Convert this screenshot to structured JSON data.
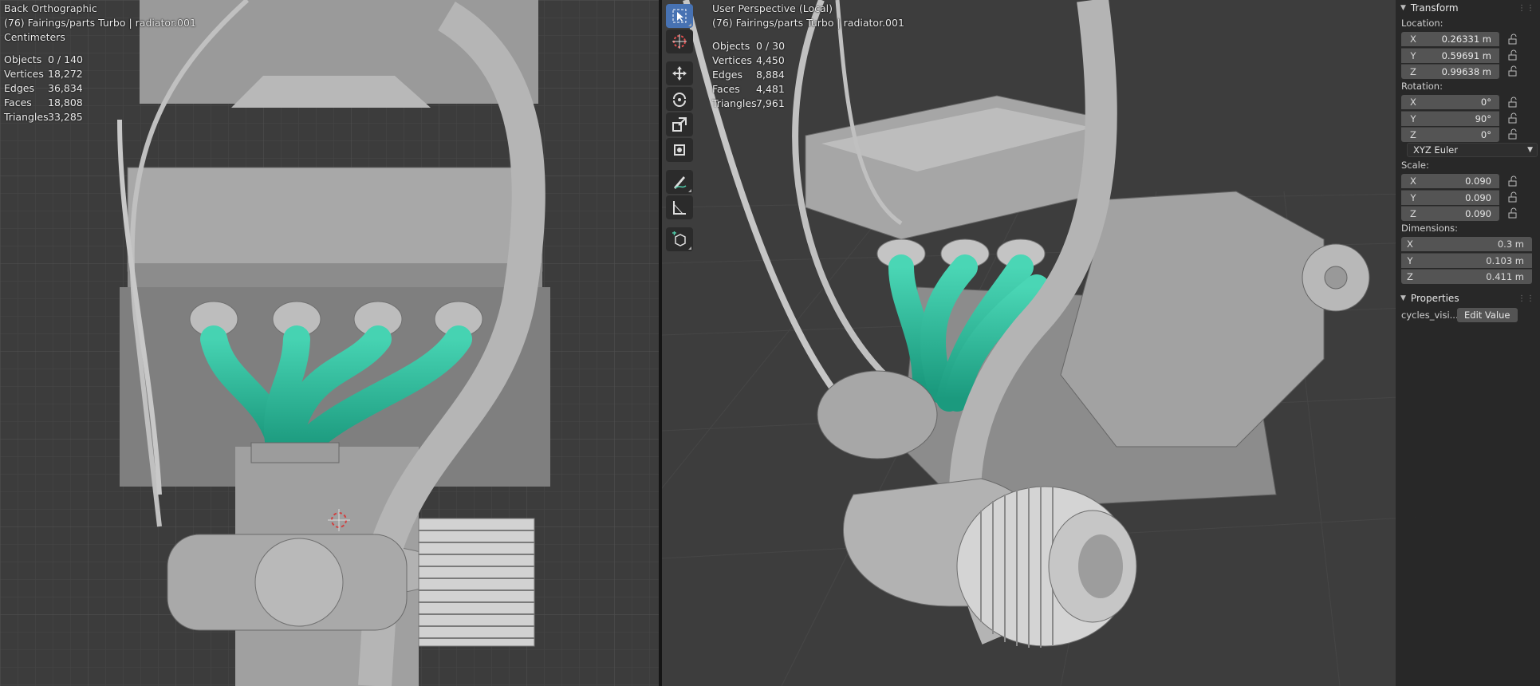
{
  "left_viewport": {
    "view_name": "Back Orthographic",
    "object_path": "(76) Fairings/parts Turbo | radiator.001",
    "units": "Centimeters",
    "stats": [
      {
        "label": "Objects",
        "value": "0 / 140"
      },
      {
        "label": "Vertices",
        "value": "18,272"
      },
      {
        "label": "Edges",
        "value": "36,834"
      },
      {
        "label": "Faces",
        "value": "18,808"
      },
      {
        "label": "Triangles",
        "value": "33,285"
      }
    ]
  },
  "right_viewport": {
    "view_name": "User Perspective (Local)",
    "object_path": "(76) Fairings/parts Turbo | radiator.001",
    "stats": [
      {
        "label": "Objects",
        "value": "0 / 30"
      },
      {
        "label": "Vertices",
        "value": "4,450"
      },
      {
        "label": "Edges",
        "value": "8,884"
      },
      {
        "label": "Faces",
        "value": "4,481"
      },
      {
        "label": "Triangles",
        "value": "7,961"
      }
    ]
  },
  "toolbar": {
    "tools": [
      {
        "name": "select-box-icon",
        "active": true
      },
      {
        "name": "cursor-icon",
        "active": false
      },
      {
        "name": "move-icon",
        "active": false
      },
      {
        "name": "rotate-icon",
        "active": false
      },
      {
        "name": "scale-icon",
        "active": false
      },
      {
        "name": "transform-icon",
        "active": false
      },
      {
        "name": "annotate-icon",
        "active": false
      },
      {
        "name": "measure-icon",
        "active": false
      },
      {
        "name": "add-cube-icon",
        "active": false
      }
    ]
  },
  "properties": {
    "transform_header": "Transform",
    "location_label": "Location:",
    "location": [
      {
        "axis": "X",
        "value": "0.26331 m"
      },
      {
        "axis": "Y",
        "value": "0.59691 m"
      },
      {
        "axis": "Z",
        "value": "0.99638 m"
      }
    ],
    "rotation_label": "Rotation:",
    "rotation": [
      {
        "axis": "X",
        "value": "0°"
      },
      {
        "axis": "Y",
        "value": "90°"
      },
      {
        "axis": "Z",
        "value": "0°"
      }
    ],
    "rotation_mode": "XYZ Euler",
    "scale_label": "Scale:",
    "scale": [
      {
        "axis": "X",
        "value": "0.090"
      },
      {
        "axis": "Y",
        "value": "0.090"
      },
      {
        "axis": "Z",
        "value": "0.090"
      }
    ],
    "dimensions_label": "Dimensions:",
    "dimensions": [
      {
        "axis": "X",
        "value": "0.3 m"
      },
      {
        "axis": "Y",
        "value": "0.103 m"
      },
      {
        "axis": "Z",
        "value": "0.411 m"
      }
    ],
    "properties_header": "Properties",
    "custom_prop_label": "cycles_visi...",
    "custom_prop_button": "Edit Value"
  },
  "colors": {
    "viewport_bg": "#3d3d3d",
    "grid": "#484848",
    "mesh": "#b4b4b4",
    "selected_mesh": "#2fb899",
    "active_tool": "#4772b3"
  }
}
